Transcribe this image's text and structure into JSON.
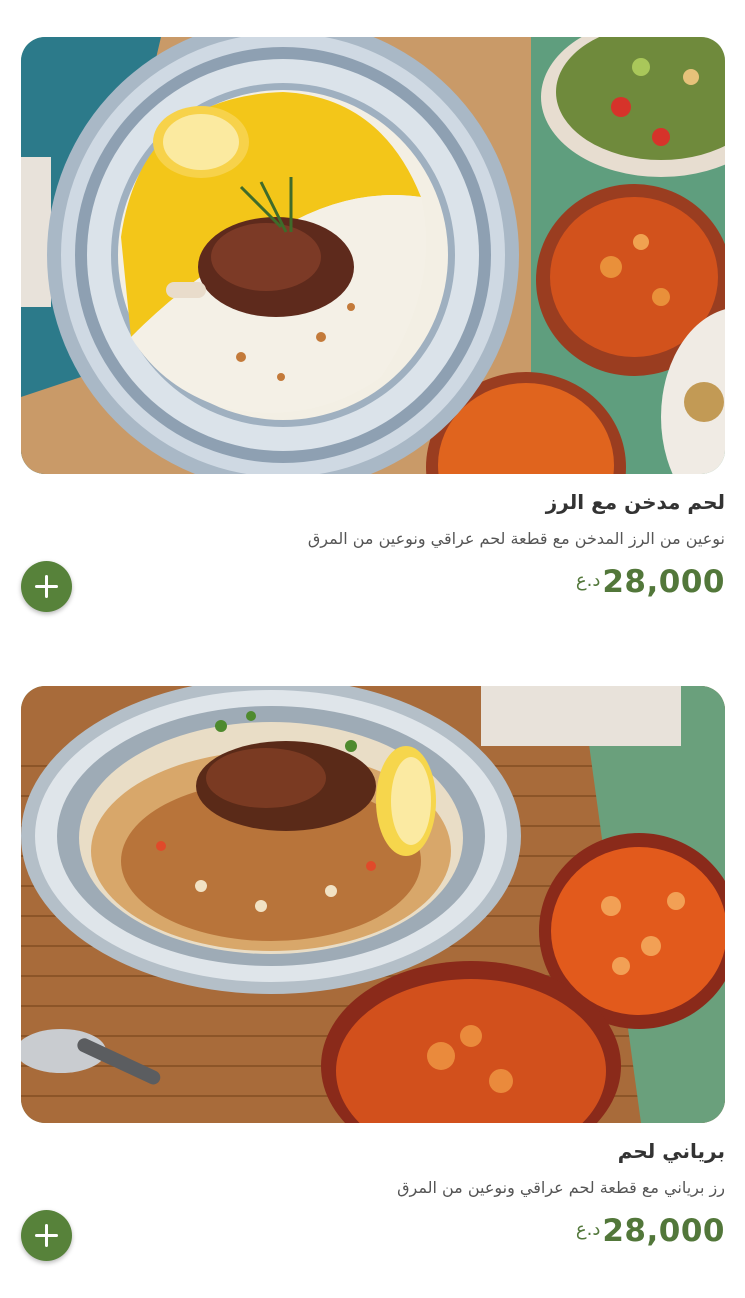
{
  "menu_items": [
    {
      "title": "لحم مدخن مع الرز",
      "description": "نوعين من الرز المدخن مع قطعة لحم عراقي ونوعين من المرق",
      "price_amount": "28,000",
      "price_currency": "د.ع",
      "image_icon": "smoked-meat-rice-photo",
      "add_icon": "plus-icon"
    },
    {
      "title": "برياني لحم",
      "description": "رز برياني مع قطعة لحم عراقي ونوعين من المرق",
      "price_amount": "28,000",
      "price_currency": "د.ع",
      "image_icon": "meat-biryani-photo",
      "add_icon": "plus-icon"
    }
  ],
  "colors": {
    "accent_green": "#57823a",
    "price_green": "#52773a",
    "title_text": "#333333",
    "description_text": "#555555"
  }
}
